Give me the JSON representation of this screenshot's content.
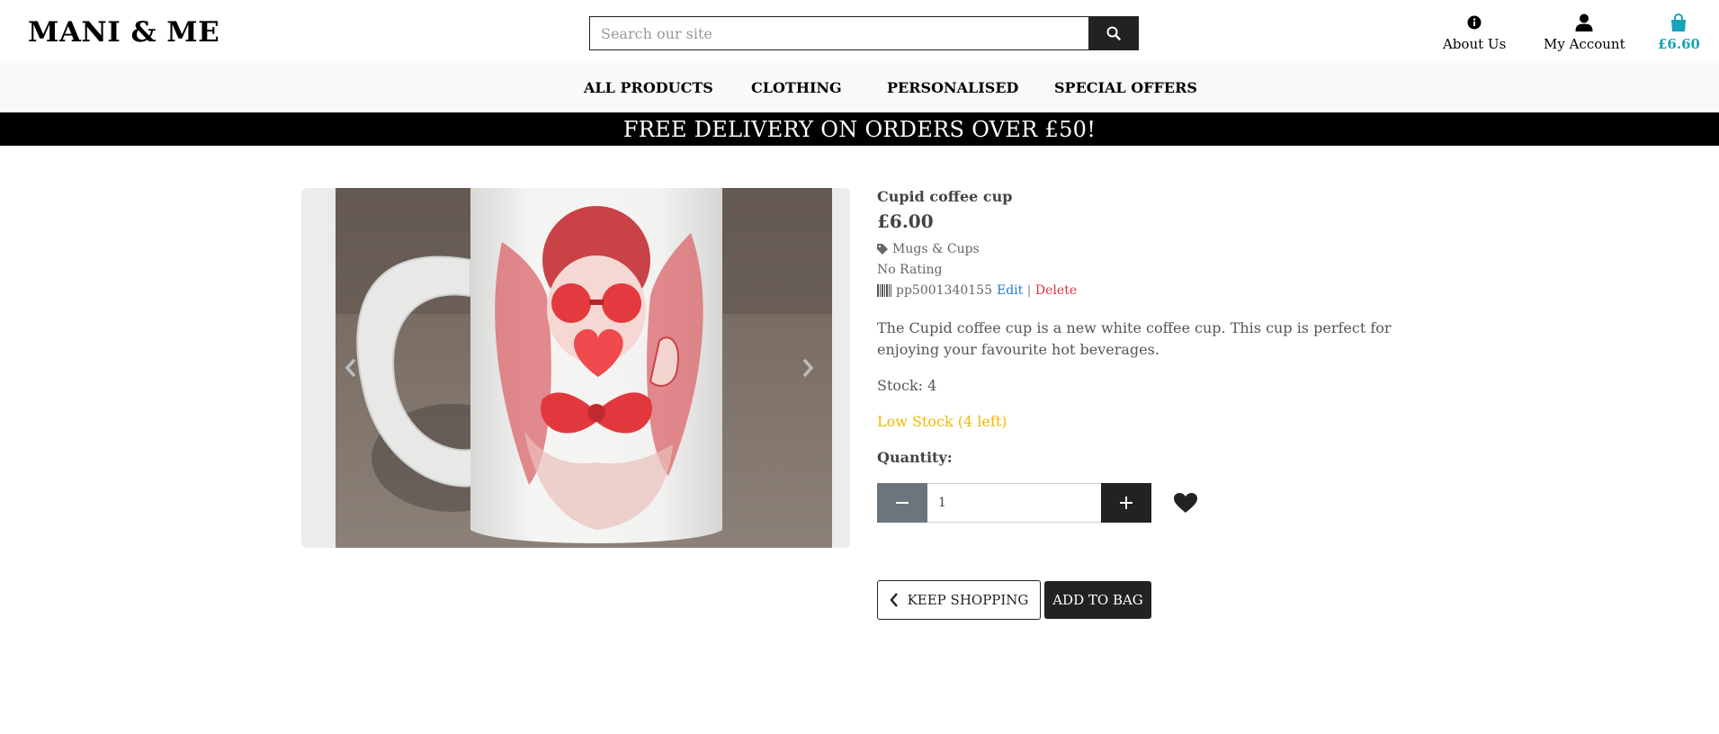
{
  "header": {
    "logo": "MANI & ME",
    "search_placeholder": "Search our site",
    "about_label": "About Us",
    "account_label": "My Account",
    "bag_total": "£6.60",
    "accent_color": "#17a2b8"
  },
  "nav": {
    "items": [
      {
        "label": "ALL PRODUCTS"
      },
      {
        "label": "CLOTHING"
      },
      {
        "label": "PERSONALISED"
      },
      {
        "label": "SPECIAL OFFERS"
      }
    ]
  },
  "banner": {
    "text": "FREE DELIVERY ON ORDERS OVER £50!"
  },
  "product": {
    "name": "Cupid coffee cup",
    "price": "£6.00",
    "category": "Mugs & Cups",
    "rating": "No Rating",
    "sku": "pp5001340155",
    "edit_label": "Edit",
    "separator": "|",
    "delete_label": "Delete",
    "description": "The Cupid coffee cup is a new white coffee cup. This cup is perfect for enjoying your favourite hot beverages.",
    "stock_text": "Stock: 4",
    "low_stock_text": "Low Stock (4 left)",
    "low_stock_color": "#f0b800",
    "quantity_label": "Quantity:",
    "quantity_value": "1"
  },
  "actions": {
    "keep_shopping": "KEEP SHOPPING",
    "add_to_bag": "ADD TO BAG"
  },
  "icons": {
    "search": "search-icon",
    "about": "info-icon",
    "account": "user-icon",
    "bag": "shopping-bag-icon",
    "category": "tag-icon",
    "sku": "barcode-icon",
    "minus": "minus-icon",
    "plus": "plus-icon",
    "wishlist": "heart-icon",
    "prev": "chevron-left-icon",
    "next": "chevron-right-icon",
    "keep_shopping": "chevron-left-icon"
  }
}
